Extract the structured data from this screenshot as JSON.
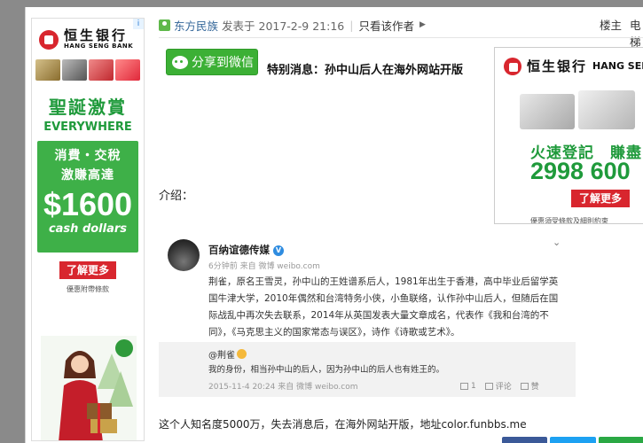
{
  "left_ad": {
    "adchoice": "i",
    "brand_cn": "恒生银行",
    "brand_en": "HANG SENG BANK",
    "headline_cn": "聖誕激賞",
    "headline_en": "EVERYWHERE",
    "line1": "消費・交稅",
    "line2": "激賺高達",
    "amount": "$1600",
    "amount_sub": "cash dollars",
    "cta": "了解更多",
    "fineprint": "優惠附帶條款"
  },
  "post_header": {
    "author": "东方民族",
    "posted": "发表于 2017-2-9 21:16",
    "only_author": "只看该作者",
    "floor": "楼主",
    "electric": "电梯"
  },
  "share": {
    "label": "分享到微信"
  },
  "post_title": "特别消息：孙中山后人在海外网站开版",
  "right_ad": {
    "brand_cn": "恒生银行",
    "brand_en": "HANG SENG",
    "line1": "火速登記　賺盡",
    "amount": "2998 600",
    "cta": "了解更多",
    "fineprint": "優惠須受條款及細則約束"
  },
  "intro_label": "介绍：",
  "weibo": {
    "name": "百纳谊德传媒",
    "meta": "6分钟前 来自 微博 weibo.com",
    "text": "荆雀，原名王雪灵，孙中山的王姓谱系后人，1981年出生于香港，高中毕业后留学英国牛津大学，2010年偶然和台湾特务小侠，小鱼联络，认作孙中山后人，但随后在国际战乱中再次失去联系，2014年从英国发表大量文章成名，代表作《我和台湾的不同》，《马克思主义的国家常态与误区》，诗作《诗歌或艺术》。",
    "repost_name": "@荆雀",
    "repost_text": "我的身份，相当孙中山的后人，因为孙中山的后人也有姓王的。",
    "repost_meta": "2015-11-4 20:24 来自 微博 weibo.com",
    "repost_count": "1",
    "comment_label": "评论",
    "like_label": "赞"
  },
  "bottom_text": "这个人知名度5000万，失去消息后，在海外网站开版，地址color.funbbs.me"
}
